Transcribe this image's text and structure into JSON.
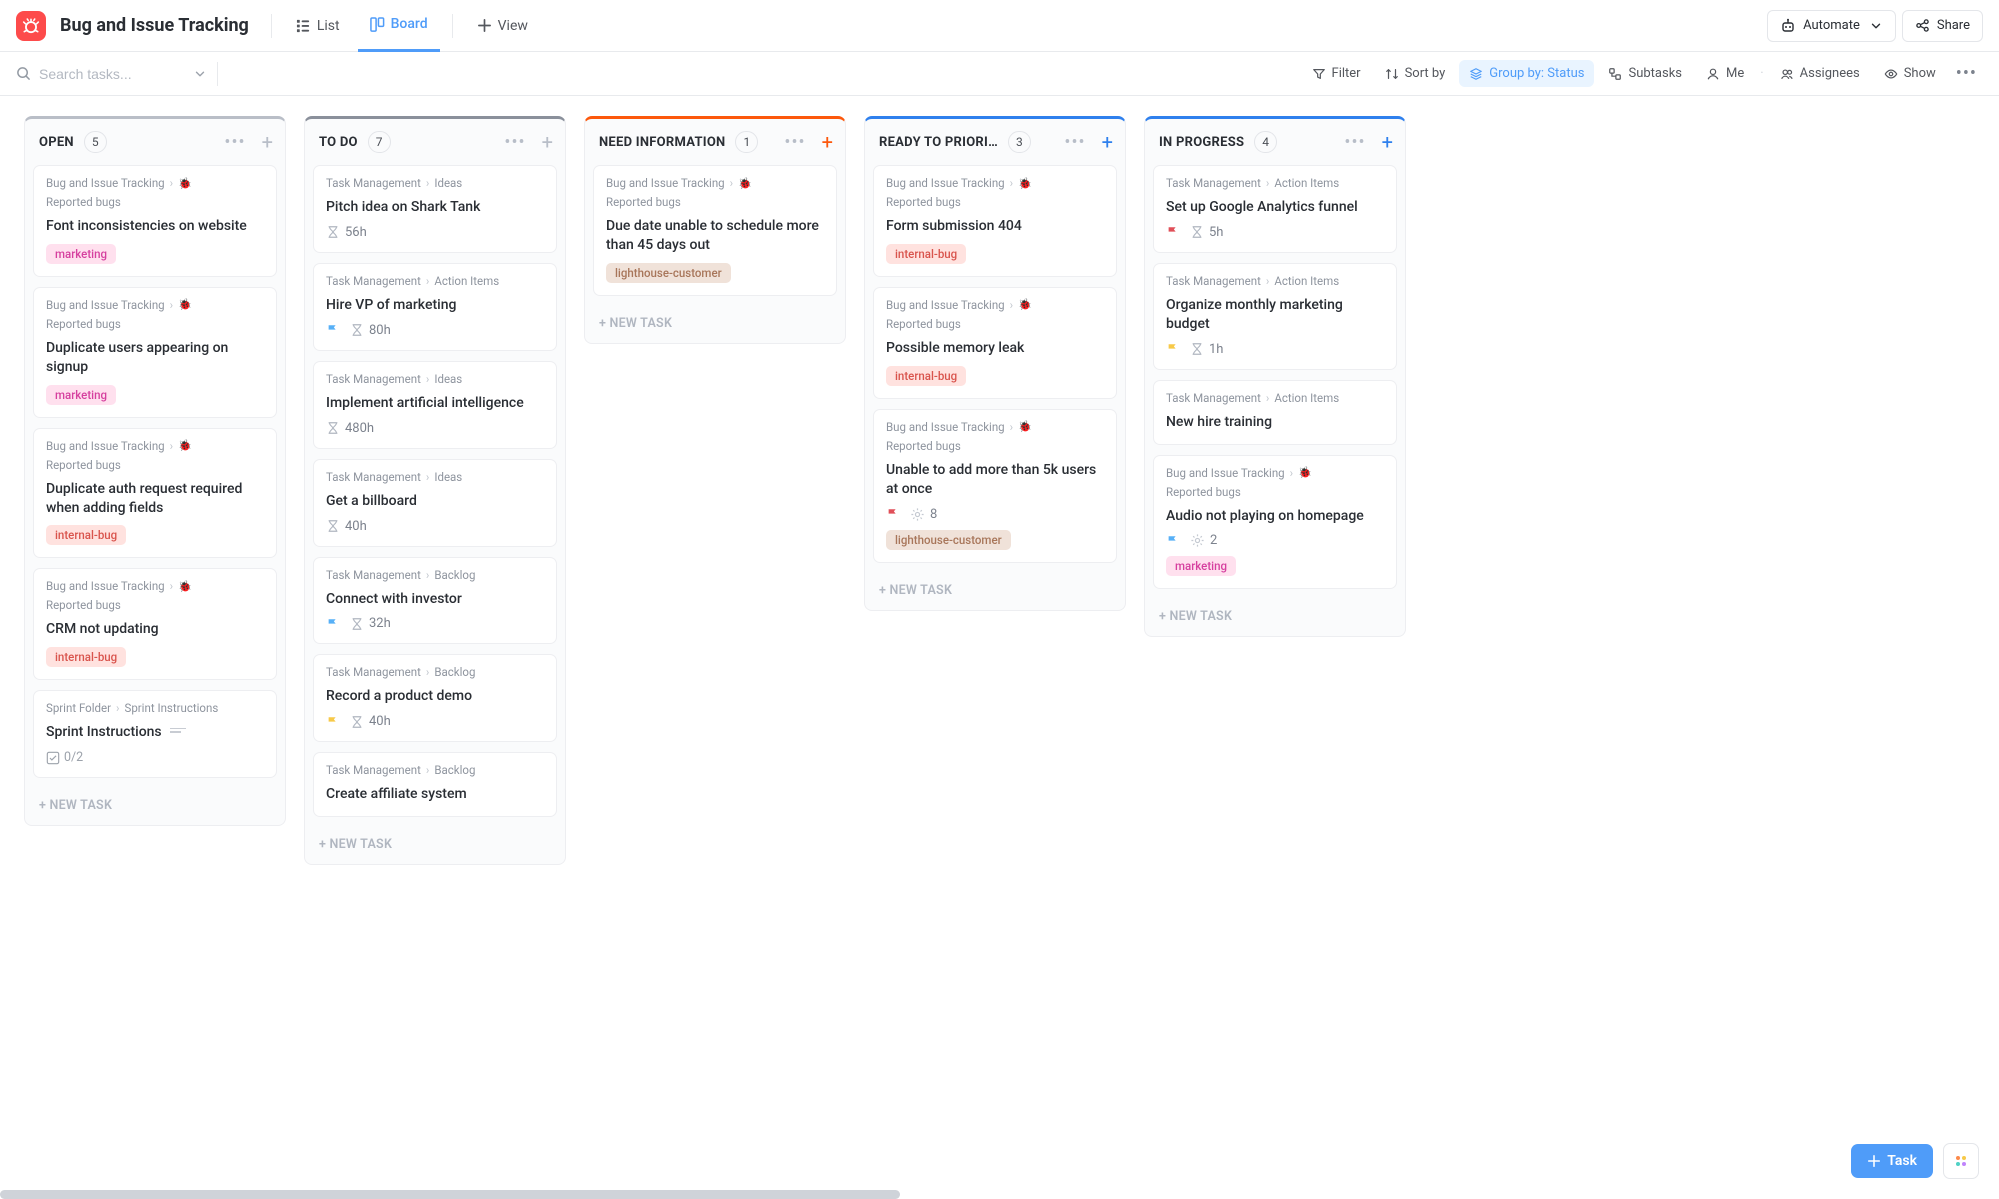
{
  "header": {
    "space_title": "Bug and Issue Tracking",
    "views": {
      "list": "List",
      "board": "Board",
      "add_view": "View"
    },
    "automate": "Automate",
    "share": "Share"
  },
  "toolbar": {
    "search_placeholder": "Search tasks...",
    "filter": "Filter",
    "sort_by": "Sort by",
    "group_by": "Group by: Status",
    "subtasks": "Subtasks",
    "me": "Me",
    "assignees": "Assignees",
    "show": "Show"
  },
  "new_task_label": "+ NEW TASK",
  "fab": {
    "task": "Task"
  },
  "columns": [
    {
      "id": "open",
      "title": "OPEN",
      "count": "5",
      "color": "#b9bec7",
      "plus_accent": false,
      "cards": [
        {
          "crumb_a": "Bug and Issue Tracking",
          "crumb_b": "Reported bugs",
          "crumb_bug": true,
          "title": "Font inconsistencies on website",
          "tags": [
            "marketing"
          ]
        },
        {
          "crumb_a": "Bug and Issue Tracking",
          "crumb_b": "Reported bugs",
          "crumb_bug": true,
          "title": "Duplicate users appearing on signup",
          "tags": [
            "marketing"
          ]
        },
        {
          "crumb_a": "Bug and Issue Tracking",
          "crumb_b": "Reported bugs",
          "crumb_bug": true,
          "title": "Duplicate auth request required when adding fields",
          "tags": [
            "internal-bug"
          ]
        },
        {
          "crumb_a": "Bug and Issue Tracking",
          "crumb_b": "Reported bugs",
          "crumb_bug": true,
          "title": "CRM not updating",
          "tags": [
            "internal-bug"
          ]
        },
        {
          "crumb_a": "Sprint Folder",
          "crumb_b": "Sprint Instructions",
          "crumb_bug": false,
          "title": "Sprint Instructions",
          "desc": true,
          "check": "0/2"
        }
      ]
    },
    {
      "id": "todo",
      "title": "TO DO",
      "count": "7",
      "color": "#8a909b",
      "plus_accent": false,
      "cards": [
        {
          "crumb_a": "Task Management",
          "crumb_b": "Ideas",
          "title": "Pitch idea on Shark Tank",
          "hour": "56h"
        },
        {
          "crumb_a": "Task Management",
          "crumb_b": "Action Items",
          "title": "Hire VP of marketing",
          "flag": "blue",
          "hour": "80h"
        },
        {
          "crumb_a": "Task Management",
          "crumb_b": "Ideas",
          "title": "Implement artificial intelligence",
          "hour": "480h"
        },
        {
          "crumb_a": "Task Management",
          "crumb_b": "Ideas",
          "title": "Get a billboard",
          "hour": "40h"
        },
        {
          "crumb_a": "Task Management",
          "crumb_b": "Backlog",
          "title": "Connect with investor",
          "flag": "blue",
          "hour": "32h"
        },
        {
          "crumb_a": "Task Management",
          "crumb_b": "Backlog",
          "title": "Record a product demo",
          "flag": "yellow",
          "hour": "40h"
        },
        {
          "crumb_a": "Task Management",
          "crumb_b": "Backlog",
          "title": "Create affiliate system"
        }
      ]
    },
    {
      "id": "need-info",
      "title": "NEED INFORMATION",
      "count": "1",
      "color": "#fc580c",
      "plus_accent": true,
      "cards": [
        {
          "crumb_a": "Bug and Issue Tracking",
          "crumb_b": "Reported bugs",
          "crumb_bug": true,
          "title": "Due date unable to schedule more than 45 days out",
          "tags": [
            "lighthouse-customer"
          ]
        }
      ]
    },
    {
      "id": "ready",
      "title": "READY TO PRIORI…",
      "count": "3",
      "color": "#2f80ed",
      "plus_accent": true,
      "cards": [
        {
          "crumb_a": "Bug and Issue Tracking",
          "crumb_b": "Reported bugs",
          "crumb_bug": true,
          "title": "Form submission 404",
          "tags": [
            "internal-bug"
          ]
        },
        {
          "crumb_a": "Bug and Issue Tracking",
          "crumb_b": "Reported bugs",
          "crumb_bug": true,
          "title": "Possible memory leak",
          "tags": [
            "internal-bug"
          ]
        },
        {
          "crumb_a": "Bug and Issue Tracking",
          "crumb_b": "Reported bugs",
          "crumb_bug": true,
          "title": "Unable to add more than 5k users at once",
          "flag": "red",
          "sprint": "8",
          "tags": [
            "lighthouse-customer"
          ]
        }
      ]
    },
    {
      "id": "in-progress",
      "title": "IN PROGRESS",
      "count": "4",
      "color": "#2f80ed",
      "plus_accent": true,
      "cards": [
        {
          "crumb_a": "Task Management",
          "crumb_b": "Action Items",
          "title": "Set up Google Analytics funnel",
          "flag": "red",
          "hour": "5h"
        },
        {
          "crumb_a": "Task Management",
          "crumb_b": "Action Items",
          "title": "Organize monthly marketing budget",
          "flag": "yellow",
          "hour": "1h"
        },
        {
          "crumb_a": "Task Management",
          "crumb_b": "Action Items",
          "title": "New hire training"
        },
        {
          "crumb_a": "Bug and Issue Tracking",
          "crumb_b": "Reported bugs",
          "crumb_bug": true,
          "title": "Audio not playing on homepage",
          "flag": "blue",
          "sprint": "2",
          "tags": [
            "marketing"
          ]
        }
      ]
    }
  ]
}
